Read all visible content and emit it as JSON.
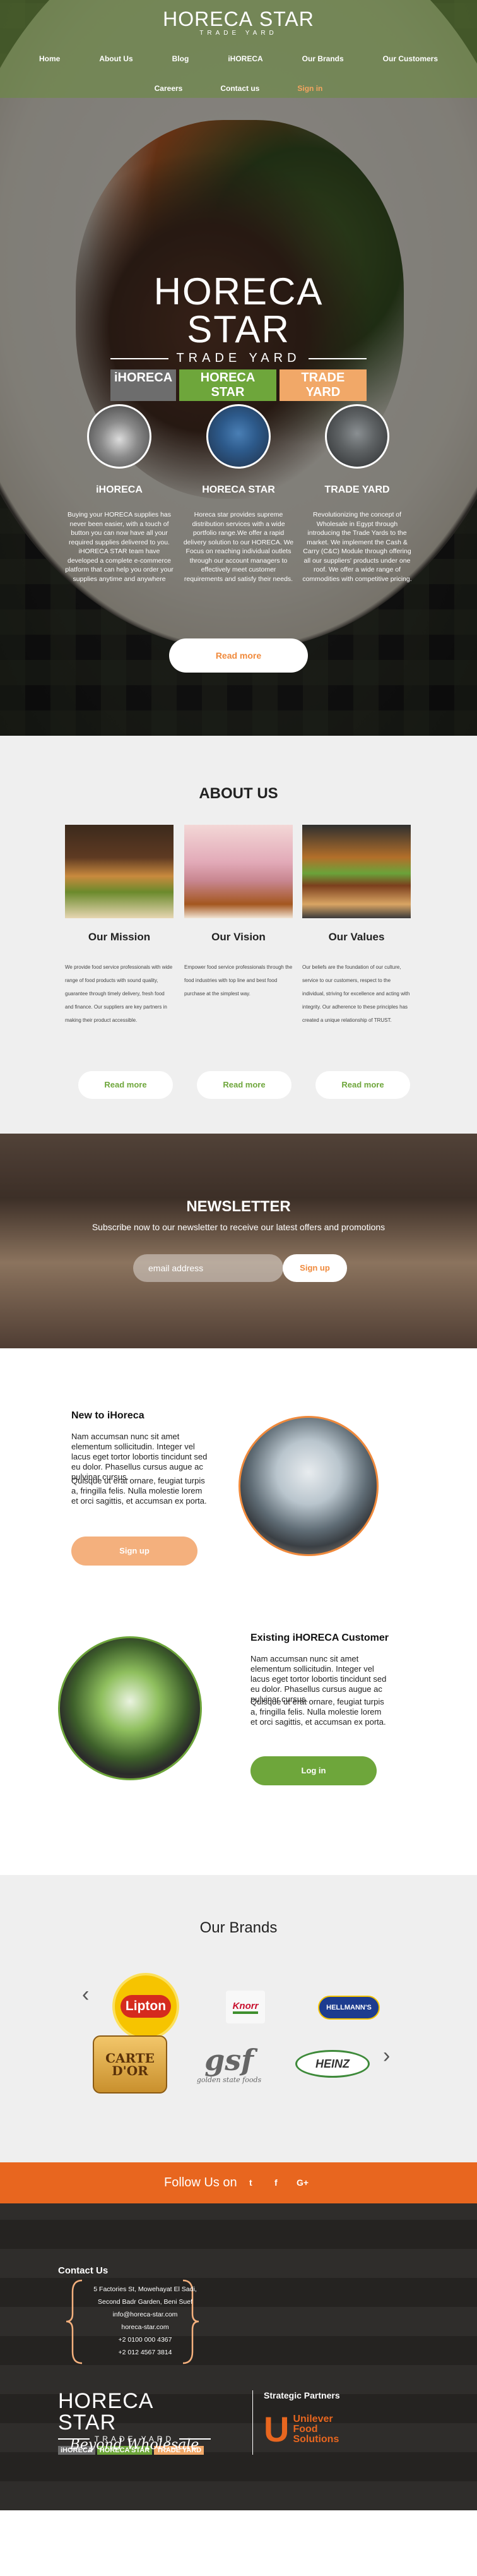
{
  "nav": {
    "logo_main": "HORECA",
    "logo_star": "STAR",
    "logo_sub": "TRADE YARD",
    "row1": [
      "Home",
      "About Us",
      "Blog",
      "iHORECA",
      "Our Brands",
      "Our Customers"
    ],
    "row2": [
      "Careers",
      "Contact us",
      "Sign in"
    ]
  },
  "hero": {
    "logo_main": "HORECA",
    "logo_star": "STAR",
    "logo_sub": "TRADE YARD",
    "tab1": "iHORECA",
    "tab2": "HORECA STAR",
    "tab3": "TRADE YARD",
    "columns": [
      {
        "title": "iHORECA",
        "text": "Buying your HORECA supplies has never been easier, with a touch of button you can now have all your required supplies delivered to you. iHORECA STAR team have developed a complete e-commerce platform that can help you order your supplies anytime and anywhere"
      },
      {
        "title": "HORECA STAR",
        "text": "Horeca star provides supreme distribution services with a wide portfolio range.We offer a rapid delivery solution to our HORECA. We Focus on reaching individual outlets through our account managers to effectively meet customer requirements and satisfy their needs."
      },
      {
        "title": "TRADE YARD",
        "text": "Revolutionizing the concept of Wholesale in Egypt through introducing the Trade Yards to the market. We implement the Cash & Carry (C&C) Module through offering all our suppliers' products under one roof. We offer a wide range of commodities with competitive pricing."
      }
    ],
    "read_more": "Read more"
  },
  "about": {
    "title": "ABOUT US",
    "cards": [
      {
        "title": "Our Mission",
        "text": "We provide food service professionals with wide range of food products with sound quality, guarantee through timely delivery, fresh food and finance. Our suppliers are key partners in making their product accessible."
      },
      {
        "title": "Our Vision",
        "text": "Empower food service professionals through the food industries with top line and best food purchase at the simplest way."
      },
      {
        "title": "Our Values",
        "text": "Our beliefs are the foundation of our culture, service to our customers, respect to the individual, striving for excellence and acting with integrity. Our adherence to these principles has created a unique relationship of TRUST."
      }
    ],
    "read_more": "Read more"
  },
  "newsletter": {
    "title": "NEWSLETTER",
    "subtitle": "Subscribe now to our newsletter to receive our latest offers and promotions",
    "placeholder": "email address",
    "button": "Sign up"
  },
  "customers": {
    "new_title": "New to iHoreca",
    "new_p1": "Nam accumsan nunc sit amet elementum sollicitudin. Integer vel lacus eget tortor lobortis tincidunt sed eu dolor. Phasellus cursus augue ac pulvinar cursus.",
    "new_p2": "Quisque ut erat ornare, feugiat turpis a, fringilla felis. Nulla molestie lorem et orci sagittis, et accumsan ex porta.",
    "new_button": "Sign up",
    "ex_title": "Existing iHORECA Customer",
    "ex_p1": "Nam accumsan nunc sit amet elementum sollicitudin. Integer vel lacus eget tortor lobortis tincidunt sed eu dolor. Phasellus cursus augue ac pulvinar cursus.",
    "ex_p2": "Quisque ut erat ornare, feugiat turpis a, fringilla felis. Nulla molestie lorem et orci sagittis, et accumsan ex porta.",
    "ex_button": "Log in"
  },
  "brands": {
    "title": "Our Brands",
    "prev_icon": "chevron-left-icon",
    "next_icon": "chevron-right-icon",
    "logos": [
      "Lipton",
      "Knorr",
      "HELLMANN'S",
      "CARTE D'OR",
      "gsf",
      "golden state foods",
      "HEINZ"
    ]
  },
  "follow": {
    "label": "Follow Us on",
    "icons": [
      "twitter-icon",
      "facebook-icon",
      "google-plus-icon"
    ]
  },
  "footer": {
    "contact_title": "Contact Us",
    "address_lines": [
      "5 Factories St, Mowehayat El Sadi,",
      "Second Badr Garden, Beni Suef",
      "info@horeca-star.com",
      "horeca-star.com",
      "+2 0100 000 4367",
      "+2 012 4567 3814"
    ],
    "slogan": "Beyond Wholesale",
    "partners_title": "Strategic Partners",
    "partner_name_1": "Unilever",
    "partner_name_2": "Food",
    "partner_name_3": "Solutions"
  },
  "colors": {
    "orange": "#e8661f",
    "green": "#6ea63b",
    "peach": "#f4b07d"
  }
}
